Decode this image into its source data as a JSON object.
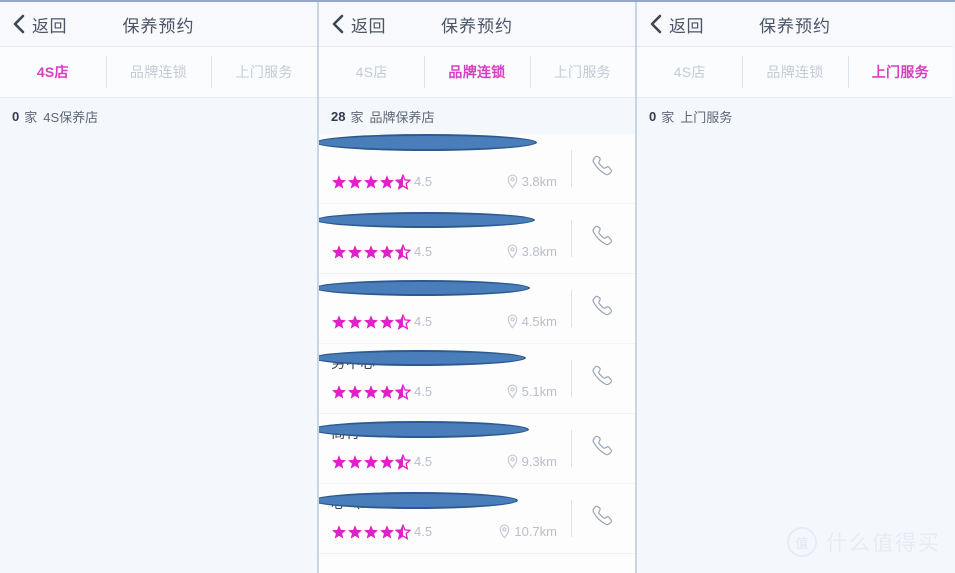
{
  "app": {
    "nav": {
      "back_label": "返回",
      "title": "保养预约"
    },
    "tabs": [
      {
        "label": "4S店"
      },
      {
        "label": "品牌连锁"
      },
      {
        "label": "上门服务"
      }
    ]
  },
  "panels": [
    {
      "active_tab": 0,
      "count": {
        "num": "0",
        "unit": "家",
        "label": "4S保养店"
      },
      "rows": []
    },
    {
      "active_tab": 1,
      "count": {
        "num": "28",
        "unit": "家",
        "label": "品牌保养店"
      },
      "rows": [
        {
          "name": "",
          "rating": "4.5",
          "distance": "3.8km"
        },
        {
          "name": "",
          "rating": "4.5",
          "distance": "3.8km"
        },
        {
          "name": "",
          "rating": "4.5",
          "distance": "4.5km"
        },
        {
          "name": "务中心",
          "rating": "4.5",
          "distance": "5.1km"
        },
        {
          "name": "商行",
          "rating": "4.5",
          "distance": "9.3km"
        },
        {
          "name": "心（...",
          "rating": "4.5",
          "distance": "10.7km"
        }
      ]
    },
    {
      "active_tab": 2,
      "count": {
        "num": "0",
        "unit": "家",
        "label": "上门服务"
      },
      "rows": []
    }
  ],
  "watermark": {
    "badge": "值",
    "text": "什么值得买"
  },
  "colors": {
    "accent": "#d83fc0",
    "star": "#e020c8",
    "nav_text": "#4b5566",
    "muted": "#c3cad6",
    "page_bg": "#f4f7fb",
    "redaction": "#4a7ebb"
  }
}
